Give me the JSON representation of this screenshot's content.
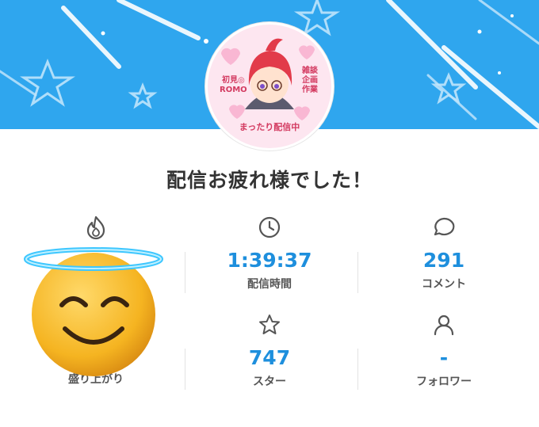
{
  "header": {
    "accent": "#2fa6ee",
    "avatar": {
      "left_text": "初見◎\nROMO",
      "right_text": "雑談\n企画\n作業",
      "bottom_text": "まったり配信中"
    }
  },
  "title": "配信お疲れ様でした！",
  "stats": [
    {
      "icon": "flame-icon",
      "value": "",
      "label": "盛り上がり"
    },
    {
      "icon": "clock-icon",
      "value": "1:39:37",
      "label": "配信時間"
    },
    {
      "icon": "comment-icon",
      "value": "291",
      "label": "コメント"
    },
    {
      "icon": "star-icon",
      "value": "747",
      "label": "スター"
    },
    {
      "icon": "person-icon",
      "value": "-",
      "label": "フォロワー"
    }
  ],
  "colors": {
    "value": "#1e8fdd",
    "label": "#555555",
    "title": "#333333"
  }
}
